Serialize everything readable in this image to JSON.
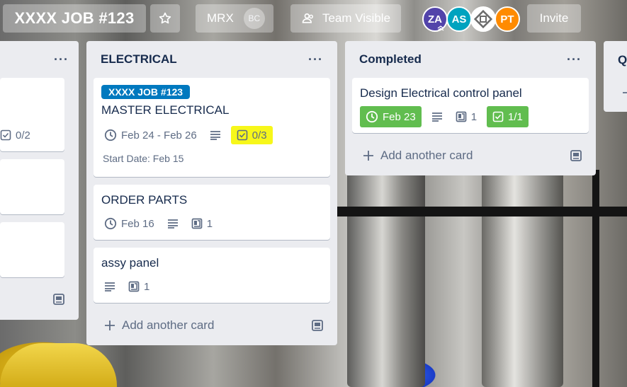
{
  "header": {
    "board_title": "XXXX JOB #123",
    "org_name": "MRX",
    "org_badge": "BC",
    "visibility": "Team Visible",
    "invite_label": "Invite",
    "members": [
      {
        "initials": "ZA",
        "color": "#5243aa"
      },
      {
        "initials": "AS",
        "color": "#00a3bf"
      },
      {
        "initials": "",
        "color": "#ffffff"
      },
      {
        "initials": "PT",
        "color": "#ff8b00"
      }
    ]
  },
  "lists": {
    "left": {
      "checklist": "0/2"
    },
    "electrical": {
      "title": "ELECTRICAL",
      "menu": "···",
      "add_card": "Add another card",
      "cards": [
        {
          "label": "XXXX JOB #123",
          "title": "MASTER ELECTRICAL",
          "due": "Feb 24 - Feb 26",
          "checklist": "0/3",
          "start_date": "Start Date: Feb 15"
        },
        {
          "title": "ORDER PARTS",
          "due": "Feb 16",
          "attachments": "1"
        },
        {
          "title": "assy panel",
          "attachments": "1"
        }
      ]
    },
    "completed": {
      "title": "Completed",
      "menu": "···",
      "add_card": "Add another card",
      "cards": [
        {
          "title": "Design Electrical control panel",
          "due": "Feb 23",
          "attachments": "1",
          "checklist": "1/1"
        }
      ]
    },
    "right": {
      "title_fragment": "Q"
    }
  },
  "colors": {
    "label_blue": "#0079bf",
    "complete_green": "#61bd4f",
    "highlight_yellow": "#f7f71a"
  }
}
